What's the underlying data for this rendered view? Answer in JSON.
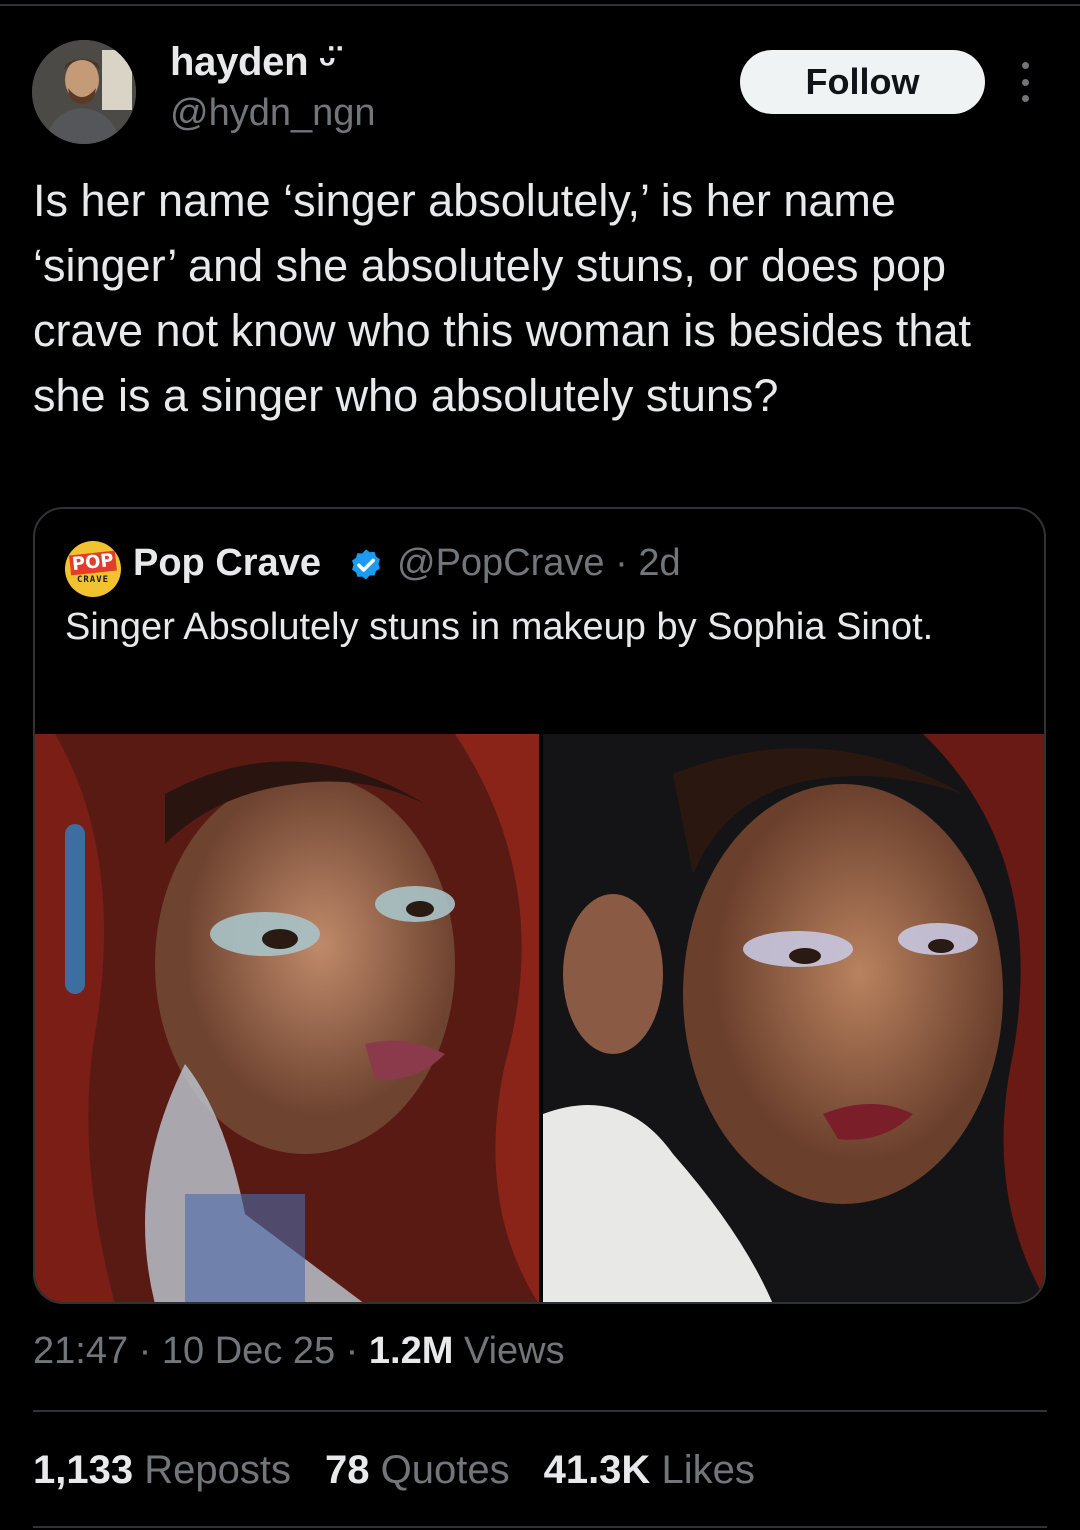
{
  "author": {
    "display_name": "hayden ᵕ̈",
    "handle": "@hydn_ngn",
    "follow_label": "Follow"
  },
  "tweet": {
    "text": "Is her name ‘singer absolutely,’ is her name ‘singer’ and she absolutely stuns, or does pop crave not know who this woman is besides that she is a singer who absolutely stuns?"
  },
  "quote": {
    "logo_top": "POP",
    "logo_bottom": "CRAVE",
    "name": "Pop Crave",
    "meta": "@PopCrave · 2d",
    "text": "Singer Absolutely stuns in makeup by Sophia Sinot."
  },
  "footer": {
    "time": "21:47",
    "date": "10 Dec 25",
    "views_count": "1.2M",
    "views_label": "Views"
  },
  "stats": {
    "reposts_count": "1,133",
    "reposts_label": "Reposts",
    "quotes_count": "78",
    "quotes_label": "Quotes",
    "likes_count": "41.3K",
    "likes_label": "Likes"
  },
  "colors": {
    "background": "#000000",
    "text_primary": "#e7e9ea",
    "text_secondary": "#71767b",
    "border": "#2f3336",
    "verified": "#1d9bf0",
    "follow_button": "#eff3f4"
  },
  "icons": [
    "more-icon",
    "verified-icon"
  ]
}
